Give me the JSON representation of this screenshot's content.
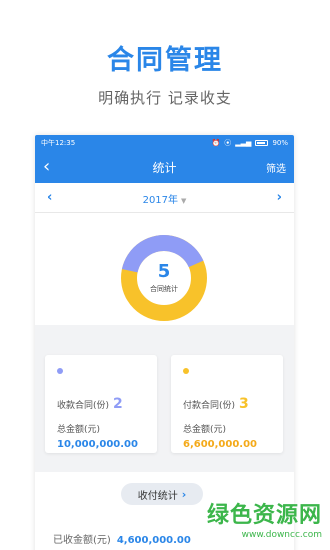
{
  "header": {
    "title": "合同管理",
    "subtitle": "明确执行  记录收支"
  },
  "statusbar": {
    "left": "中午12:35",
    "battery": "90%"
  },
  "nav": {
    "title": "统计",
    "filter": "筛选"
  },
  "yearbar": {
    "year": "2017年"
  },
  "donut": {
    "count": "5",
    "label": "合同统计",
    "received_fraction": 0.4,
    "paid_fraction": 0.6,
    "colors": {
      "received": "#8f9cf6",
      "paid": "#f8c22a"
    }
  },
  "cards": [
    {
      "type_label": "收款合同(份)",
      "count": "2",
      "amount_label": "总金额(元)",
      "amount": "10,000,000.00",
      "color": "#8f9cf6"
    },
    {
      "type_label": "付款合同(份)",
      "count": "3",
      "amount_label": "总金额(元)",
      "amount": "6,600,000.00",
      "color": "#f8c22a"
    }
  ],
  "bottom": {
    "pill_label": "收付统计",
    "received_label": "已收金额(元)",
    "received_amount": "4,600,000.00"
  },
  "watermark": {
    "main": "绿色资源网",
    "url": "www.downcc.com"
  },
  "colors": {
    "accent": "#2a86e8",
    "count_purple": "#8f9cf6",
    "count_orange": "#f8c22a",
    "watermark_green": "#3cb64b"
  }
}
